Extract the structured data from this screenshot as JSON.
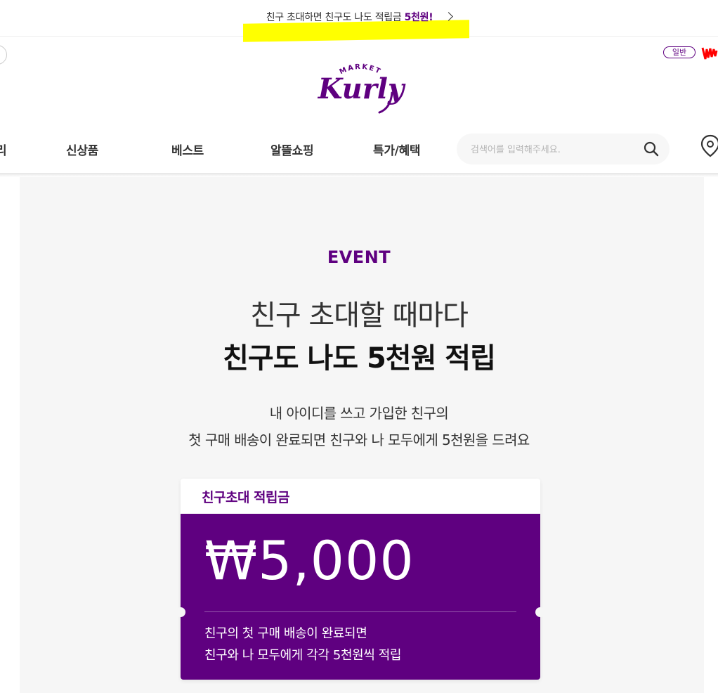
{
  "banner": {
    "text_prefix": "친구 초대하면 친구도 나도 적립금 ",
    "text_highlight": "5천원!"
  },
  "header": {
    "badge": "일반",
    "logo_top": "MARKET",
    "logo_main": "Kurly"
  },
  "nav": {
    "items": [
      {
        "label": "리"
      },
      {
        "label": "신상품"
      },
      {
        "label": "베스트"
      },
      {
        "label": "알뜰쇼핑"
      },
      {
        "label": "특가/혜택"
      }
    ],
    "search_placeholder": "검색어를 입력해주세요."
  },
  "event": {
    "label": "EVENT",
    "headline_1": "친구 초대할 때마다",
    "headline_2": "친구도 나도 5천원 적립",
    "desc_1": "내 아이디를 쓰고 가입한 친구의",
    "desc_2": "첫 구매 배송이 완료되면 친구와 나 모두에게 5천원을 드려요"
  },
  "card": {
    "title": "친구초대 적립금",
    "amount": "₩5,000",
    "desc_1": "친구의 첫 구매 배송이 완료되면",
    "desc_2": "친구와 나 모두에게 각각 5천원씩 적립"
  },
  "colors": {
    "brand": "#5f0080",
    "highlight": "#ffff00",
    "panel": "#f6f6f6"
  }
}
